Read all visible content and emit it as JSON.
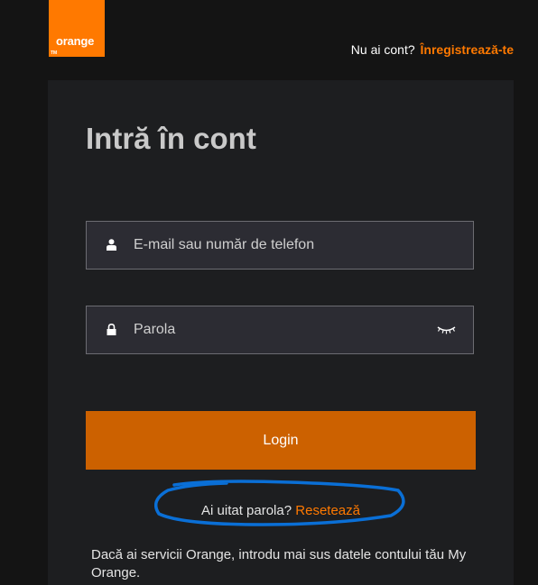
{
  "header": {
    "logo_text": "orange",
    "logo_tm": "TM",
    "no_account_text": "Nu ai cont?",
    "register_link": "Înregistrează-te"
  },
  "login": {
    "title": "Intră în cont",
    "email_placeholder": "E-mail sau număr de telefon",
    "password_placeholder": "Parola",
    "login_button": "Login",
    "forgot_text": "Ai uitat parola?",
    "reset_link": "Resetează",
    "info_text": "Dacă ai servicii Orange, introdu mai sus datele contului tău My Orange."
  },
  "icons": {
    "email_field": "user-icon",
    "password_field": "lock-icon",
    "show_password": "eye-closed-icon"
  },
  "colors": {
    "brand": "#ff7900",
    "button": "#cc6100",
    "annotation": "#0a6fd6"
  }
}
